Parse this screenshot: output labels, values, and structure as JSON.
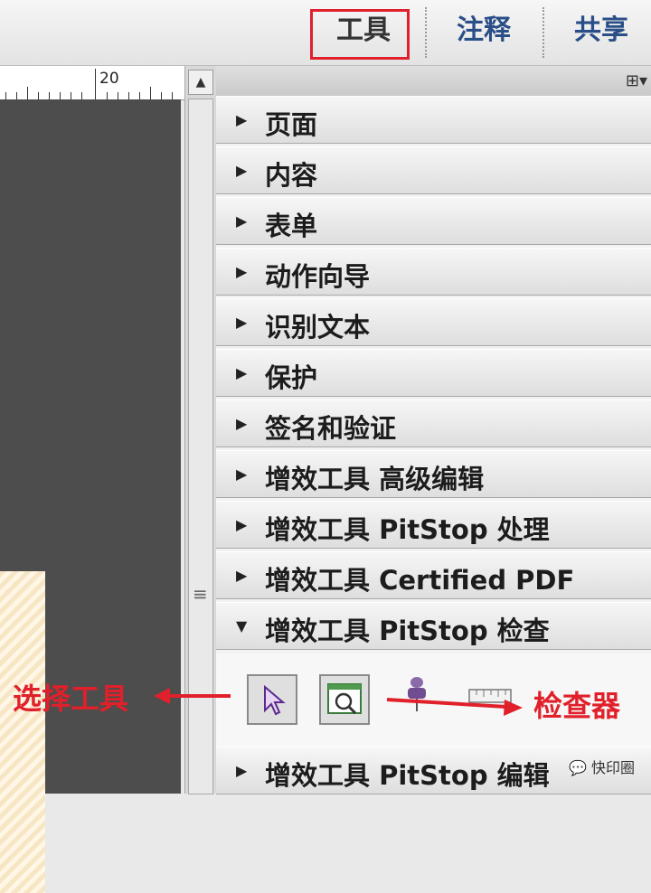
{
  "toolbar": {
    "tabs": [
      {
        "label": "工具",
        "active": true
      },
      {
        "label": "注释",
        "active": false
      },
      {
        "label": "共享",
        "active": false
      }
    ]
  },
  "ruler": {
    "mark": "20"
  },
  "panel": {
    "options_icon": "panel-options-icon",
    "items": [
      {
        "label": "页面"
      },
      {
        "label": "内容"
      },
      {
        "label": "表单"
      },
      {
        "label": "动作向导"
      },
      {
        "label": "识别文本"
      },
      {
        "label": "保护"
      },
      {
        "label": "签名和验证"
      },
      {
        "label": "增效工具 高级编辑"
      },
      {
        "label": "增效工具 PitStop 处理"
      },
      {
        "label": "增效工具 Certified PDF"
      },
      {
        "label": "增效工具 PitStop 检查"
      },
      {
        "label": "增效工具 PitStop 编辑"
      }
    ]
  },
  "annotations": {
    "select_tool": "选择工具",
    "inspector": "检查器",
    "color": "#e0202a"
  },
  "watermark": "快印圈"
}
